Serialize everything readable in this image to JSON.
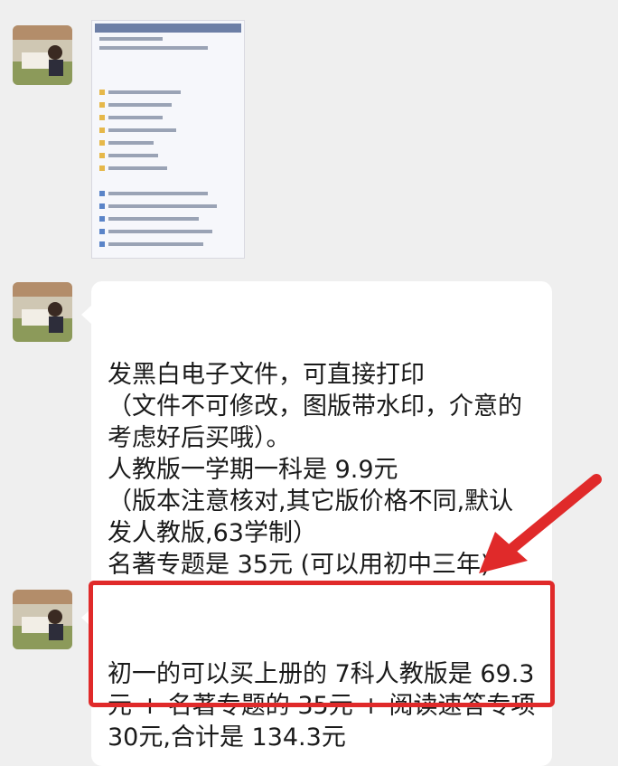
{
  "messages": [
    {
      "type": "image",
      "description_icon": "folder-listing-screenshot"
    },
    {
      "type": "text",
      "text": "发黑白电子文件，可直接打印\n（文件不可修改，图版带水印，介意的考虑好后买哦）。\n人教版一学期一科是 9.9元\n（版本注意核对,其它版价格不同,默认发人教版,63学制）\n名著专题是 35元 (可以用初中三年)"
    },
    {
      "type": "text",
      "text": "初一的可以买上册的 7科人教版是 69.3元 + 名著专题的 35元 + 阅读速答专项 30元,合计是 134.3元"
    }
  ],
  "colors": {
    "highlight": "#e02a2a",
    "background": "#efefef",
    "bubble": "#ffffff"
  },
  "icons": {
    "avatar": "avatar-icon",
    "arrow": "red-arrow-icon"
  }
}
